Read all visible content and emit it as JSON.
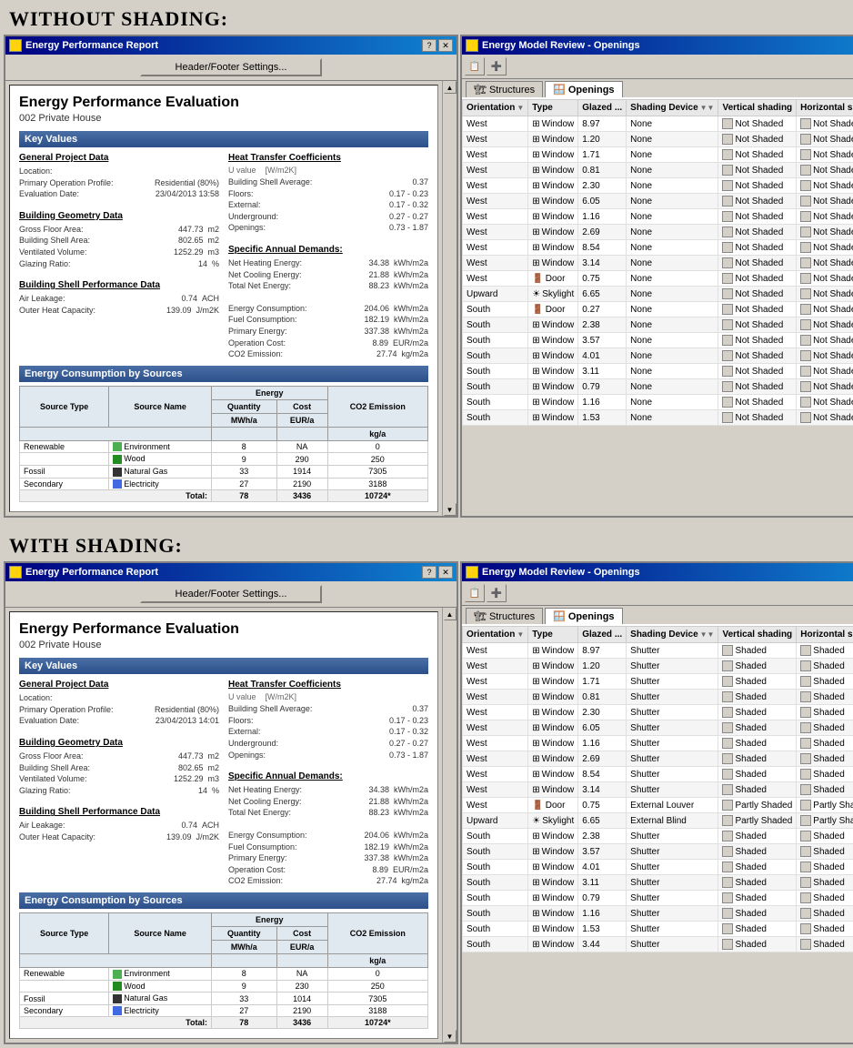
{
  "sections": {
    "without_shading": {
      "label": "Without shading:"
    },
    "with_shading": {
      "label": "With shading:"
    }
  },
  "epr_window": {
    "title": "Energy Performance Report",
    "header_footer_btn": "Header/Footer Settings...",
    "main_title": "Energy Performance Evaluation",
    "subtitle": "002 Private House",
    "key_values_header": "Key Values",
    "general_project": {
      "title": "General Project Data",
      "rows": [
        {
          "label": "Location:",
          "value": ""
        },
        {
          "label": "Primary Operation Profile:",
          "value": "Residential (80%)"
        },
        {
          "label": "Evaluation Date:",
          "value": "23/04/2013 13:58"
        }
      ]
    },
    "building_geometry": {
      "title": "Building Geometry Data",
      "rows": [
        {
          "label": "Gross Floor Area:",
          "value": "447.73  m2"
        },
        {
          "label": "Building Shell Area:",
          "value": "802.65  m2"
        },
        {
          "label": "Ventilated Volume:",
          "value": "1252.29  m3"
        },
        {
          "label": "Glazing Ratio:",
          "value": "14  %"
        }
      ]
    },
    "building_shell": {
      "title": "Building Shell Performance Data",
      "rows": [
        {
          "label": "Air Leakage:",
          "value": "0.74  ACH"
        },
        {
          "label": "Outer Heat Capacity:",
          "value": "139.09  J/m2K"
        }
      ]
    },
    "heat_transfer": {
      "title": "Heat Transfer Coefficients",
      "rows": [
        {
          "label": "Building Shell Average:",
          "value": "0.37"
        },
        {
          "label": "Floors:",
          "value": "0.17 - 0.23"
        },
        {
          "label": "External:",
          "value": "0.17 - 0.32"
        },
        {
          "label": "Underground:",
          "value": "0.27 - 0.27"
        },
        {
          "label": "Openings:",
          "value": "0.73 - 1.87"
        }
      ],
      "u_label": "U value",
      "unit": "[W/m2K]"
    },
    "specific_annual": {
      "title": "Specific Annual Demands:",
      "rows": [
        {
          "label": "Net Heating Energy:",
          "value": "34.38",
          "unit": "kWh/m2a"
        },
        {
          "label": "Net Cooling Energy:",
          "value": "21.88",
          "unit": "kWh/m2a"
        },
        {
          "label": "Total Net Energy:",
          "value": "88.23",
          "unit": "kWh/m2a"
        }
      ]
    },
    "energy_consumption": {
      "rows": [
        {
          "label": "Energy Consumption:",
          "value": "204.06",
          "unit": "kWh/m2a"
        },
        {
          "label": "Fuel Consumption:",
          "value": "182.19",
          "unit": "kWh/m2a"
        },
        {
          "label": "Primary Energy:",
          "value": "337.38",
          "unit": "kWh/m2a"
        },
        {
          "label": "Operation Cost:",
          "value": "8.89",
          "unit": "EUR/m2a"
        },
        {
          "label": "CO2 Emission:",
          "value": "27.74",
          "unit": "kg/m2a"
        }
      ]
    },
    "energy_sources_header": "Energy Consumption by Sources",
    "sources_table": {
      "col_headers": [
        "Source Type",
        "Source Name",
        "Energy",
        "",
        "CO2 Emission"
      ],
      "sub_headers": [
        "",
        "",
        "Quantity",
        "Cost",
        ""
      ],
      "units": [
        "",
        "",
        "MWh/a",
        "EUR/a",
        "kg/a"
      ],
      "rows": [
        {
          "type": "Renewable",
          "color": "#4caf50",
          "name": "Environment",
          "qty": "8",
          "cost": "NA",
          "co2": "0"
        },
        {
          "type": "",
          "color": "#228b22",
          "name": "Wood",
          "qty": "9",
          "cost": "290",
          "co2": "250"
        },
        {
          "type": "Fossil",
          "color": "#333333",
          "name": "Natural Gas",
          "qty": "33",
          "cost": "1914",
          "co2": "7305"
        },
        {
          "type": "Secondary",
          "color": "#4169e1",
          "name": "Electricity",
          "qty": "27",
          "cost": "2190",
          "co2": "3188"
        }
      ],
      "total_row": {
        "label": "Total:",
        "qty": "78",
        "cost": "3436",
        "co2": "10724*"
      }
    }
  },
  "emr_window": {
    "title": "Energy Model Review - Openings",
    "tabs": [
      "Structures",
      "Openings"
    ],
    "active_tab": "Openings",
    "columns": [
      "Orientation",
      "Type",
      "Glazed ...",
      "Shading Device",
      "Vertical shading",
      "Horizontal shading"
    ],
    "without_shading_rows": [
      {
        "orientation": "West",
        "type": "Window",
        "glazed": "8.97",
        "device": "None",
        "vertical": "Not Shaded",
        "horizontal": "Not Shaded"
      },
      {
        "orientation": "West",
        "type": "Window",
        "glazed": "1.20",
        "device": "None",
        "vertical": "Not Shaded",
        "horizontal": "Not Shaded"
      },
      {
        "orientation": "West",
        "type": "Window",
        "glazed": "1.71",
        "device": "None",
        "vertical": "Not Shaded",
        "horizontal": "Not Shaded"
      },
      {
        "orientation": "West",
        "type": "Window",
        "glazed": "0.81",
        "device": "None",
        "vertical": "Not Shaded",
        "horizontal": "Not Shaded"
      },
      {
        "orientation": "West",
        "type": "Window",
        "glazed": "2.30",
        "device": "None",
        "vertical": "Not Shaded",
        "horizontal": "Not Shaded"
      },
      {
        "orientation": "West",
        "type": "Window",
        "glazed": "6.05",
        "device": "None",
        "vertical": "Not Shaded",
        "horizontal": "Not Shaded"
      },
      {
        "orientation": "West",
        "type": "Window",
        "glazed": "1.16",
        "device": "None",
        "vertical": "Not Shaded",
        "horizontal": "Not Shaded"
      },
      {
        "orientation": "West",
        "type": "Window",
        "glazed": "2.69",
        "device": "None",
        "vertical": "Not Shaded",
        "horizontal": "Not Shaded"
      },
      {
        "orientation": "West",
        "type": "Window",
        "glazed": "8.54",
        "device": "None",
        "vertical": "Not Shaded",
        "horizontal": "Not Shaded"
      },
      {
        "orientation": "West",
        "type": "Window",
        "glazed": "3.14",
        "device": "None",
        "vertical": "Not Shaded",
        "horizontal": "Not Shaded"
      },
      {
        "orientation": "West",
        "type": "Door",
        "glazed": "0.75",
        "device": "None",
        "vertical": "Not Shaded",
        "horizontal": "Not Shaded"
      },
      {
        "orientation": "Upward",
        "type": "Skylight",
        "glazed": "6.65",
        "device": "None",
        "vertical": "Not Shaded",
        "horizontal": "Not Shaded"
      },
      {
        "orientation": "South",
        "type": "Door",
        "glazed": "0.27",
        "device": "None",
        "vertical": "Not Shaded",
        "horizontal": "Not Shaded"
      },
      {
        "orientation": "South",
        "type": "Window",
        "glazed": "2.38",
        "device": "None",
        "vertical": "Not Shaded",
        "horizontal": "Not Shaded"
      },
      {
        "orientation": "South",
        "type": "Window",
        "glazed": "3.57",
        "device": "None",
        "vertical": "Not Shaded",
        "horizontal": "Not Shaded"
      },
      {
        "orientation": "South",
        "type": "Window",
        "glazed": "4.01",
        "device": "None",
        "vertical": "Not Shaded",
        "horizontal": "Not Shaded"
      },
      {
        "orientation": "South",
        "type": "Window",
        "glazed": "3.11",
        "device": "None",
        "vertical": "Not Shaded",
        "horizontal": "Not Shaded"
      },
      {
        "orientation": "South",
        "type": "Window",
        "glazed": "0.79",
        "device": "None",
        "vertical": "Not Shaded",
        "horizontal": "Not Shaded"
      },
      {
        "orientation": "South",
        "type": "Window",
        "glazed": "1.16",
        "device": "None",
        "vertical": "Not Shaded",
        "horizontal": "Not Shaded"
      },
      {
        "orientation": "South",
        "type": "Window",
        "glazed": "1.53",
        "device": "None",
        "vertical": "Not Shaded",
        "horizontal": "Not Shaded"
      }
    ],
    "with_shading_rows": [
      {
        "orientation": "West",
        "type": "Window",
        "glazed": "8.97",
        "device": "Shutter",
        "vertical": "Shaded",
        "horizontal": "Shaded"
      },
      {
        "orientation": "West",
        "type": "Window",
        "glazed": "1.20",
        "device": "Shutter",
        "vertical": "Shaded",
        "horizontal": "Shaded"
      },
      {
        "orientation": "West",
        "type": "Window",
        "glazed": "1.71",
        "device": "Shutter",
        "vertical": "Shaded",
        "horizontal": "Shaded"
      },
      {
        "orientation": "West",
        "type": "Window",
        "glazed": "0.81",
        "device": "Shutter",
        "vertical": "Shaded",
        "horizontal": "Shaded"
      },
      {
        "orientation": "West",
        "type": "Window",
        "glazed": "2.30",
        "device": "Shutter",
        "vertical": "Shaded",
        "horizontal": "Shaded"
      },
      {
        "orientation": "West",
        "type": "Window",
        "glazed": "6.05",
        "device": "Shutter",
        "vertical": "Shaded",
        "horizontal": "Shaded"
      },
      {
        "orientation": "West",
        "type": "Window",
        "glazed": "1.16",
        "device": "Shutter",
        "vertical": "Shaded",
        "horizontal": "Shaded"
      },
      {
        "orientation": "West",
        "type": "Window",
        "glazed": "2.69",
        "device": "Shutter",
        "vertical": "Shaded",
        "horizontal": "Shaded"
      },
      {
        "orientation": "West",
        "type": "Window",
        "glazed": "8.54",
        "device": "Shutter",
        "vertical": "Shaded",
        "horizontal": "Shaded"
      },
      {
        "orientation": "West",
        "type": "Window",
        "glazed": "3.14",
        "device": "Shutter",
        "vertical": "Shaded",
        "horizontal": "Shaded"
      },
      {
        "orientation": "West",
        "type": "Door",
        "glazed": "0.75",
        "device": "External Louver",
        "vertical": "Partly Shaded",
        "horizontal": "Partly Shaded"
      },
      {
        "orientation": "Upward",
        "type": "Skylight",
        "glazed": "6.65",
        "device": "External Blind",
        "vertical": "Partly Shaded",
        "horizontal": "Partly Shaded"
      },
      {
        "orientation": "South",
        "type": "Window",
        "glazed": "2.38",
        "device": "Shutter",
        "vertical": "Shaded",
        "horizontal": "Shaded"
      },
      {
        "orientation": "South",
        "type": "Window",
        "glazed": "3.57",
        "device": "Shutter",
        "vertical": "Shaded",
        "horizontal": "Shaded"
      },
      {
        "orientation": "South",
        "type": "Window",
        "glazed": "4.01",
        "device": "Shutter",
        "vertical": "Shaded",
        "horizontal": "Shaded"
      },
      {
        "orientation": "South",
        "type": "Window",
        "glazed": "3.11",
        "device": "Shutter",
        "vertical": "Shaded",
        "horizontal": "Shaded"
      },
      {
        "orientation": "South",
        "type": "Window",
        "glazed": "0.79",
        "device": "Shutter",
        "vertical": "Shaded",
        "horizontal": "Shaded"
      },
      {
        "orientation": "South",
        "type": "Window",
        "glazed": "1.16",
        "device": "Shutter",
        "vertical": "Shaded",
        "horizontal": "Shaded"
      },
      {
        "orientation": "South",
        "type": "Window",
        "glazed": "1.53",
        "device": "Shutter",
        "vertical": "Shaded",
        "horizontal": "Shaded"
      },
      {
        "orientation": "South",
        "type": "Window",
        "glazed": "3.44",
        "device": "Shutter",
        "vertical": "Shaded",
        "horizontal": "Shaded"
      }
    ]
  }
}
